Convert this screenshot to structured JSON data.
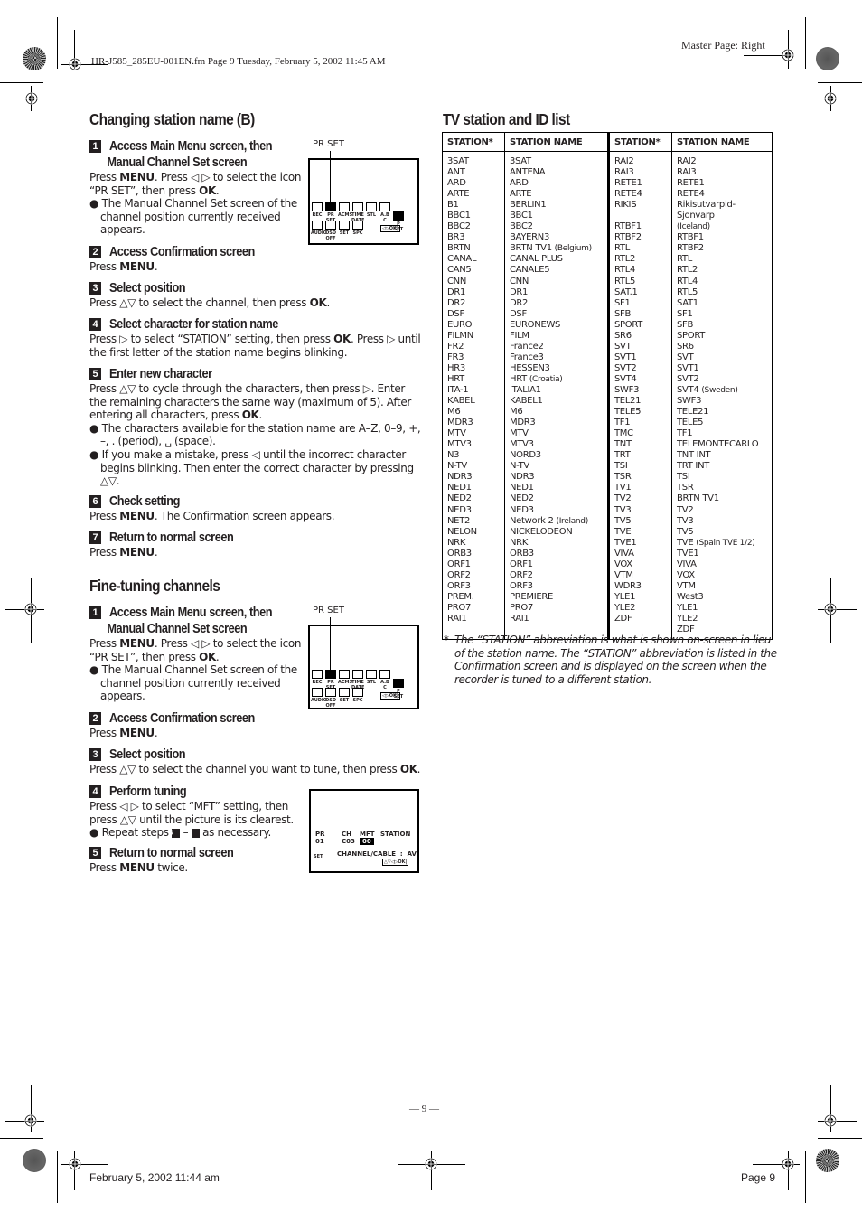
{
  "header": {
    "file_info": "HR-J585_285EU-001EN.fm  Page 9  Tuesday, February 5, 2002  11:45 AM",
    "master_page": "Master Page: Right"
  },
  "section_b": {
    "title": "Changing station name (B)",
    "steps": [
      {
        "num": "1",
        "title_line1": "Access Main Menu screen, then",
        "title_line2": "Manual Channel Set screen",
        "text_a_pre": "Press ",
        "text_a_b1": "MENU",
        "text_a_mid": ". Press ◁ ▷ to select the icon “PR SET”, then press ",
        "text_a_b2": "OK",
        "text_a_post": ".",
        "bullet": "The Manual Channel Set screen of the channel position currently received appears."
      },
      {
        "num": "2",
        "title": "Access Confirmation screen",
        "pre": "Press ",
        "bold": "MENU",
        "post": "."
      },
      {
        "num": "3",
        "title": "Select position",
        "pre": "Press △▽ to select the channel, then press ",
        "bold": "OK",
        "post": "."
      },
      {
        "num": "4",
        "title": "Select character for station name",
        "pre": "Press ▷ to select “STATION” setting, then press ",
        "bold": "OK",
        "post": ". Press ▷ until the first letter of the station name begins blinking."
      },
      {
        "num": "5",
        "title": "Enter new character",
        "pre": "Press △▽ to cycle through the characters, then press ▷. Enter the remaining characters the same way (maximum of 5). After entering all characters, press ",
        "bold": "OK",
        "post": ".",
        "bullet1": "The characters available for the station name are A–Z, 0–9, +, –, . (period), ␣ (space).",
        "bullet2": "If you make a mistake, press ◁ until the incorrect character begins blinking. Then enter the correct character by pressing △▽."
      },
      {
        "num": "6",
        "title": "Check setting",
        "pre": "Press ",
        "bold": "MENU",
        "post": ". The Confirmation screen appears."
      },
      {
        "num": "7",
        "title": "Return to normal screen",
        "pre": "Press ",
        "bold": "MENU",
        "post": "."
      }
    ]
  },
  "section_fine": {
    "title": "Fine-tuning channels",
    "steps": [
      {
        "num": "1",
        "title_line1": "Access Main Menu screen, then",
        "title_line2": "Manual Channel Set screen",
        "text_a_pre": "Press ",
        "text_a_b1": "MENU",
        "text_a_mid": ". Press ◁ ▷ to select the icon “PR SET”, then press ",
        "text_a_b2": "OK",
        "text_a_post": ".",
        "bullet": "The Manual Channel Set screen of the channel position currently received appears."
      },
      {
        "num": "2",
        "title": "Access Confirmation screen",
        "pre": "Press ",
        "bold": "MENU",
        "post": "."
      },
      {
        "num": "3",
        "title": "Select position",
        "pre": "Press △▽ to select the channel you want to tune, then press ",
        "bold": "OK",
        "post": "."
      },
      {
        "num": "4",
        "title": "Perform tuning",
        "text": "Press ◁ ▷ to select “MFT” setting, then press △▽ until the picture is its clearest.",
        "bullet_pre": "Repeat steps ",
        "bullet_from": "3",
        "bullet_mid": " – ",
        "bullet_to": "4",
        "bullet_post": " as necessary."
      },
      {
        "num": "5",
        "title": "Return to normal screen",
        "pre": "Press ",
        "bold": "MENU",
        "post": " twice."
      }
    ]
  },
  "screens": {
    "menu": {
      "pointer_label": "PR SET",
      "icons": [
        "REC",
        "PR SET",
        "ACMS",
        "TIME DATE",
        "STL",
        "A.B C",
        "AUDIO",
        "OSD OFF",
        "SET",
        "SPC",
        "P SET"
      ],
      "nav": "◁▷OK|"
    },
    "tuning": {
      "pr_label": "PR",
      "pr_value": "01",
      "ch_label": "CH",
      "ch_value": "C03",
      "mft_label": "MFT",
      "mft_value": "00",
      "station_label": "STATION",
      "set_label": "SET",
      "channel_cable": "CHANNEL/CABLE  :  AV",
      "nav": "△▽◁▷OK|"
    }
  },
  "station_list": {
    "title": "TV station and ID list",
    "headers": [
      "STATION*",
      "STATION NAME",
      "STATION*",
      "STATION NAME"
    ],
    "left": [
      [
        "3SAT",
        "3SAT"
      ],
      [
        "ANT",
        "ANTENA"
      ],
      [
        "ARD",
        "ARD"
      ],
      [
        "ARTE",
        "ARTE"
      ],
      [
        "B1",
        "BERLIN1"
      ],
      [
        "BBC1",
        "BBC1"
      ],
      [
        "BBC2",
        "BBC2"
      ],
      [
        "BR3",
        "BAYERN3"
      ],
      [
        "BRTN",
        "BRTN TV1 (Belgium)"
      ],
      [
        "CANAL",
        "CANAL PLUS"
      ],
      [
        "CAN5",
        "CANALE5"
      ],
      [
        "CNN",
        "CNN"
      ],
      [
        "DR1",
        "DR1"
      ],
      [
        "DR2",
        "DR2"
      ],
      [
        "DSF",
        "DSF"
      ],
      [
        "EURO",
        "EURONEWS"
      ],
      [
        "FILMN",
        "FILM"
      ],
      [
        "FR2",
        "France2"
      ],
      [
        "FR3",
        "France3"
      ],
      [
        "HR3",
        "HESSEN3"
      ],
      [
        "HRT",
        "HRT (Croatia)"
      ],
      [
        "ITA-1",
        "ITALIA1"
      ],
      [
        "KABEL",
        "KABEL1"
      ],
      [
        "M6",
        "M6"
      ],
      [
        "MDR3",
        "MDR3"
      ],
      [
        "MTV",
        "MTV"
      ],
      [
        "MTV3",
        "MTV3"
      ],
      [
        "N3",
        "NORD3"
      ],
      [
        "N-TV",
        "N-TV"
      ],
      [
        "NDR3",
        "NDR3"
      ],
      [
        "NED1",
        "NED1"
      ],
      [
        "NED2",
        "NED2"
      ],
      [
        "NED3",
        "NED3"
      ],
      [
        "NET2",
        "Network 2 (Ireland)"
      ],
      [
        "NELON",
        "NICKELODEON"
      ],
      [
        "NRK",
        "NRK"
      ],
      [
        "ORB3",
        "ORB3"
      ],
      [
        "ORF1",
        "ORF1"
      ],
      [
        "ORF2",
        "ORF2"
      ],
      [
        "ORF3",
        "ORF3"
      ],
      [
        "PREM.",
        "PREMIERE"
      ],
      [
        "PRO7",
        "PRO7"
      ],
      [
        "RAI1",
        "RAI1"
      ]
    ],
    "right": [
      [
        "RAI2",
        "RAI2"
      ],
      [
        "RAI3",
        "RAI3"
      ],
      [
        "RETE1",
        "RETE1"
      ],
      [
        "RETE4",
        "RETE4"
      ],
      [
        "RIKIS",
        "Rikisutvarpid-Sjonvarp (Iceland)"
      ],
      [
        "RTBF1",
        "RTBF1"
      ],
      [
        "RTBF2",
        "RTBF2"
      ],
      [
        "RTL",
        "RTL"
      ],
      [
        "RTL2",
        "RTL2"
      ],
      [
        "RTL4",
        "RTL4"
      ],
      [
        "RTL5",
        "RTL5"
      ],
      [
        "SAT.1",
        "SAT1"
      ],
      [
        "SF1",
        "SF1"
      ],
      [
        "SFB",
        "SFB"
      ],
      [
        "SPORT",
        "SPORT"
      ],
      [
        "SR6",
        "SR6"
      ],
      [
        "SVT",
        "SVT"
      ],
      [
        "SVT1",
        "SVT1"
      ],
      [
        "SVT2",
        "SVT2"
      ],
      [
        "SVT4",
        "SVT4 (Sweden)"
      ],
      [
        "SWF3",
        "SWF3"
      ],
      [
        "TEL21",
        "TELE21"
      ],
      [
        "TELE5",
        "TELE5"
      ],
      [
        "TF1",
        "TF1"
      ],
      [
        "TMC",
        "TELEMONTECARLO"
      ],
      [
        "TNT",
        "TNT INT"
      ],
      [
        "TRT",
        "TRT INT"
      ],
      [
        "TSI",
        "TSI"
      ],
      [
        "TSR",
        "TSR"
      ],
      [
        "TV1",
        "BRTN TV1"
      ],
      [
        "TV2",
        "TV2"
      ],
      [
        "TV3",
        "TV3"
      ],
      [
        "TV5",
        "TV5"
      ],
      [
        "TVE",
        "TVE (Spain TVE 1/2)"
      ],
      [
        "TVE1",
        "TVE1"
      ],
      [
        "VIVA",
        "VIVA"
      ],
      [
        "VOX",
        "VOX"
      ],
      [
        "VTM",
        "VTM"
      ],
      [
        "WDR3",
        "West3"
      ],
      [
        "YLE1",
        "YLE1"
      ],
      [
        "YLE2",
        "YLE2"
      ],
      [
        "ZDF",
        "ZDF"
      ]
    ],
    "footnote_star": "*",
    "footnote": "The “STATION” abbreviation is what is shown on-screen in lieu of the station name. The “STATION” abbreviation is listed in the Confirmation screen and is displayed on the screen when the recorder is tuned to a different station."
  },
  "footer": {
    "page_number": "— 9 —",
    "date": "February 5, 2002 11:44 am",
    "page_label": "Page 9"
  }
}
